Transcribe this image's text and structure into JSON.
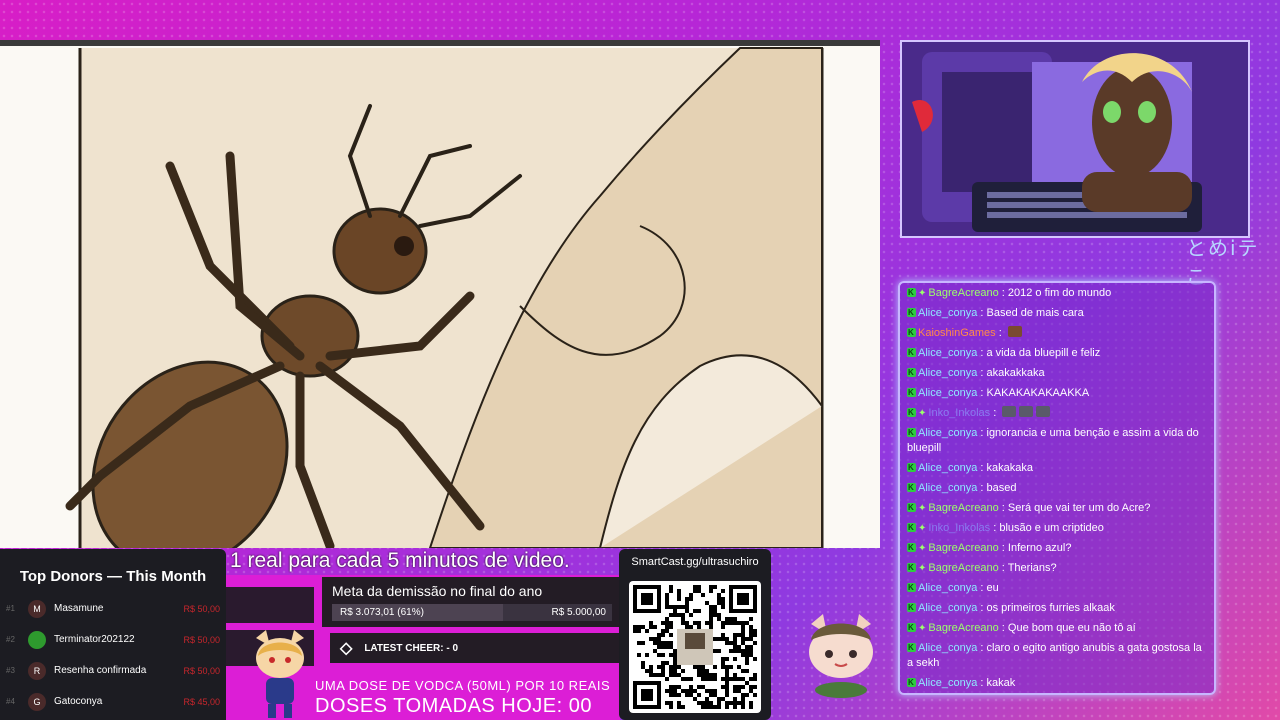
{
  "webcam": {
    "deco_text": "とめiテこ"
  },
  "subtitle": "1 real para cada 5 minutos de video.",
  "donors": {
    "title": "Top Donors — This Month",
    "rows": [
      {
        "rank": "#1",
        "initial": "M",
        "name": "Masamune",
        "amount": "R$ 50,00"
      },
      {
        "rank": "#2",
        "initial": "",
        "name": "Terminator202122",
        "amount": "R$ 50,00"
      },
      {
        "rank": "#3",
        "initial": "R",
        "name": "Resenha confirmada",
        "amount": "R$ 50,00"
      },
      {
        "rank": "#4",
        "initial": "G",
        "name": "Gatoconya",
        "amount": "R$ 45,00"
      }
    ]
  },
  "goal": {
    "title": "Meta da demissão no final do ano",
    "current": "R$ 3.073,01 (61%)",
    "target": "R$ 5.000,00",
    "progress": 0.61
  },
  "cheer": {
    "label": "LATEST CHEER: - 0"
  },
  "vodka": {
    "line1": "UMA DOSE DE VODCA (50ML) POR 10 REAIS",
    "line2": "DOSES TOMADAS HOJE: 00"
  },
  "qr": {
    "label": "SmartCast.gg/ultrasuchiro"
  },
  "chat": {
    "messages": [
      {
        "name": "BagreAcreano",
        "color": "green",
        "star": true,
        "text": "2012 o fim do mundo"
      },
      {
        "name": "Alice_conya",
        "color": "cyan",
        "star": false,
        "text": "Based de mais cara"
      },
      {
        "name": "KaioshinGames",
        "color": "orange",
        "star": false,
        "text": "",
        "emotes": 1
      },
      {
        "name": "Alice_conya",
        "color": "cyan",
        "star": false,
        "text": "a vida da bluepill e feliz"
      },
      {
        "name": "Alice_conya",
        "color": "cyan",
        "star": false,
        "text": "akakakkaka"
      },
      {
        "name": "Alice_conya",
        "color": "cyan",
        "star": false,
        "text": "KAKAKAKAKAAKKA"
      },
      {
        "name": "Inko_Inkolas",
        "color": "purple",
        "star": true,
        "text": "",
        "emotes": 3
      },
      {
        "name": "Alice_conya",
        "color": "cyan",
        "star": false,
        "text": "ignorancia e uma benção e assim a vida do bluepill"
      },
      {
        "name": "Alice_conya",
        "color": "cyan",
        "star": false,
        "text": "kakakaka"
      },
      {
        "name": "Alice_conya",
        "color": "cyan",
        "star": false,
        "text": "based"
      },
      {
        "name": "BagreAcreano",
        "color": "green",
        "star": true,
        "text": "Será que vai ter um do Acre?"
      },
      {
        "name": "Inko_Inkolas",
        "color": "purple",
        "star": true,
        "text": "blusão e um criptideo"
      },
      {
        "name": "BagreAcreano",
        "color": "green",
        "star": true,
        "text": "Inferno azul?"
      },
      {
        "name": "BagreAcreano",
        "color": "green",
        "star": true,
        "text": "Therians?"
      },
      {
        "name": "Alice_conya",
        "color": "cyan",
        "star": false,
        "text": "eu"
      },
      {
        "name": "Alice_conya",
        "color": "cyan",
        "star": false,
        "text": "os primeiros furries alkaak"
      },
      {
        "name": "BagreAcreano",
        "color": "green",
        "star": true,
        "text": "Que bom que eu não tô aí"
      },
      {
        "name": "Alice_conya",
        "color": "cyan",
        "star": false,
        "text": "claro o egito antigo anubis a gata gostosa la a sekh"
      },
      {
        "name": "Alice_conya",
        "color": "cyan",
        "star": false,
        "text": "kakak"
      }
    ]
  }
}
